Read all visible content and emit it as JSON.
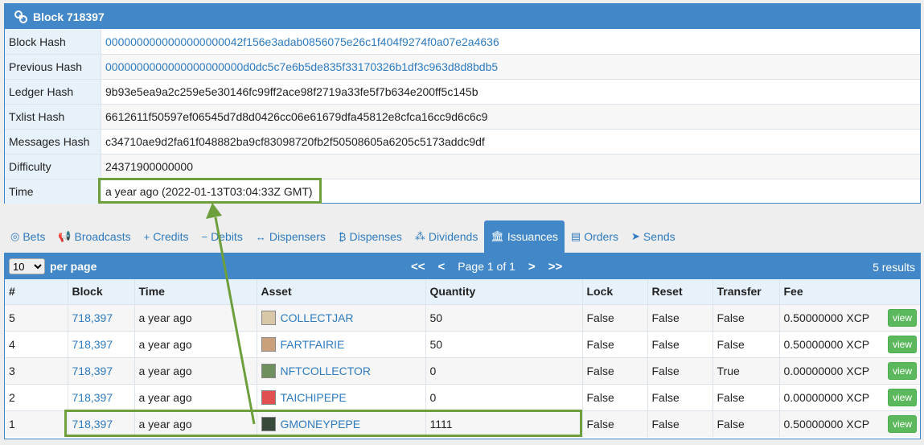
{
  "block": {
    "title": "Block 718397",
    "rows": [
      {
        "label": "Block Hash",
        "value": "0000000000000000000042f156e3adab0856075e26c1f404f9274f0a07e2a4636",
        "link": true
      },
      {
        "label": "Previous Hash",
        "value": "0000000000000000000000d0dc5c7e6b5de835f33170326b1df3c963d8d8bdb5",
        "link": true
      },
      {
        "label": "Ledger Hash",
        "value": "9b93e5ea9a2c259e5e30146fc99ff2ace98f2719a33fe5f7b634e200ff5c145b",
        "link": false
      },
      {
        "label": "Txlist Hash",
        "value": "6612611f50597ef06545d7d8d0426cc06e61679dfa45812e8cfca16cc9d6c6c9",
        "link": false
      },
      {
        "label": "Messages Hash",
        "value": "c34710ae9d2fa61f048882ba9cf83098720fb2f50508605a6205c5173addc9df",
        "link": false
      },
      {
        "label": "Difficulty",
        "value": "24371900000000",
        "link": false
      },
      {
        "label": "Time",
        "value": "a year ago (2022-01-13T03:04:33Z GMT)",
        "link": false
      }
    ]
  },
  "tabs": [
    {
      "label": "Bets",
      "icon": "◎",
      "icon_name": "bullseye-icon",
      "active": false
    },
    {
      "label": "Broadcasts",
      "icon": "📢",
      "icon_name": "bullhorn-icon",
      "active": false
    },
    {
      "label": "Credits",
      "icon": "+",
      "icon_name": "plus-icon",
      "active": false
    },
    {
      "label": "Debits",
      "icon": "−",
      "icon_name": "minus-icon",
      "active": false
    },
    {
      "label": "Dispensers",
      "icon": "↔",
      "icon_name": "arrows-h-icon",
      "active": false
    },
    {
      "label": "Dispenses",
      "icon": "₿",
      "icon_name": "bitcoin-icon",
      "active": false
    },
    {
      "label": "Dividends",
      "icon": "⁂",
      "icon_name": "sitemap-icon",
      "active": false
    },
    {
      "label": "Issuances",
      "icon": "🏛",
      "icon_name": "bank-icon",
      "active": true
    },
    {
      "label": "Orders",
      "icon": "▤",
      "icon_name": "book-icon",
      "active": false
    },
    {
      "label": "Sends",
      "icon": "➤",
      "icon_name": "paper-plane-icon",
      "active": false
    }
  ],
  "toolbar": {
    "per_page_value": "10",
    "per_page_label": "per page",
    "first": "<<",
    "prev": "<",
    "page_text": "Page 1 of 1",
    "next": ">",
    "last": ">>",
    "results": "5 results"
  },
  "table": {
    "headers": [
      "#",
      "Block",
      "Time",
      "Asset",
      "Quantity",
      "Lock",
      "Reset",
      "Transfer",
      "Fee"
    ],
    "view_label": "view",
    "rows": [
      {
        "num": "5",
        "block": "718,397",
        "time": "a year ago",
        "asset": "COLLECTJAR",
        "icon_color": "#d9c8a8",
        "quantity": "50",
        "lock": "False",
        "reset": "False",
        "transfer": "False",
        "fee": "0.50000000 XCP"
      },
      {
        "num": "4",
        "block": "718,397",
        "time": "a year ago",
        "asset": "FARTFAIRIE",
        "icon_color": "#c9a07a",
        "quantity": "50",
        "lock": "False",
        "reset": "False",
        "transfer": "False",
        "fee": "0.50000000 XCP"
      },
      {
        "num": "3",
        "block": "718,397",
        "time": "a year ago",
        "asset": "NFTCOLLECTOR",
        "icon_color": "#6f8f5e",
        "quantity": "0",
        "lock": "False",
        "reset": "False",
        "transfer": "True",
        "fee": "0.00000000 XCP"
      },
      {
        "num": "2",
        "block": "718,397",
        "time": "a year ago",
        "asset": "TAICHIPEPE",
        "icon_color": "#e05050",
        "quantity": "0",
        "lock": "False",
        "reset": "False",
        "transfer": "False",
        "fee": "0.00000000 XCP"
      },
      {
        "num": "1",
        "block": "718,397",
        "time": "a year ago",
        "asset": "GMONEYPEPE",
        "icon_color": "#3a4a3a",
        "quantity": "1111",
        "lock": "False",
        "reset": "False",
        "transfer": "False",
        "fee": "0.50000000 XCP"
      }
    ]
  },
  "colors": {
    "header_blue": "#4288c9",
    "link_blue": "#2e7bbf",
    "highlight_green": "#6d9f3c",
    "view_green": "#5cb85c"
  }
}
